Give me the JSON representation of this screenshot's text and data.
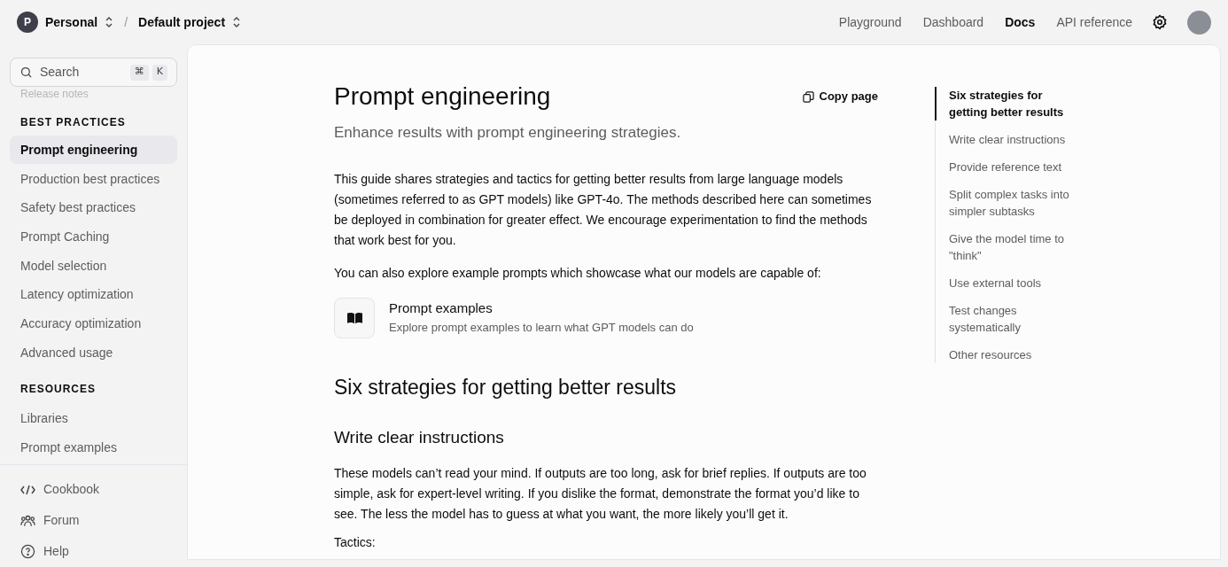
{
  "top_bar": {
    "org_initial": "P",
    "org": "Personal",
    "separator": "/",
    "project": "Default project",
    "nav": [
      {
        "label": "Playground",
        "selected": false
      },
      {
        "label": "Dashboard",
        "selected": false
      },
      {
        "label": "Docs",
        "selected": true
      },
      {
        "label": "API reference",
        "selected": false
      }
    ]
  },
  "sidebar": {
    "search": {
      "placeholder": "Search",
      "shortcut": [
        "⌘",
        "K"
      ]
    },
    "partial_item": "Release notes",
    "sections": [
      {
        "heading": "BEST PRACTICES",
        "items": [
          {
            "label": "Prompt engineering",
            "selected": true
          },
          {
            "label": "Production best practices",
            "selected": false
          },
          {
            "label": "Safety best practices",
            "selected": false
          },
          {
            "label": "Prompt Caching",
            "selected": false
          },
          {
            "label": "Model selection",
            "selected": false
          },
          {
            "label": "Latency optimization",
            "selected": false
          },
          {
            "label": "Accuracy optimization",
            "selected": false
          },
          {
            "label": "Advanced usage",
            "selected": false
          }
        ]
      },
      {
        "heading": "RESOURCES",
        "items": [
          {
            "label": "Libraries",
            "selected": false
          },
          {
            "label": "Prompt examples",
            "selected": false
          }
        ]
      }
    ],
    "footer_links": [
      {
        "kind": "code",
        "label": "Cookbook"
      },
      {
        "kind": "people",
        "label": "Forum"
      },
      {
        "kind": "help",
        "label": "Help"
      }
    ]
  },
  "article": {
    "title": "Prompt engineering",
    "copy_button": "Copy page",
    "subtitle": "Enhance results with prompt engineering strategies.",
    "intro": "This guide shares strategies and tactics for getting better results from large language models (sometimes referred to as GPT models) like GPT-4o. The methods described here can sometimes be deployed in combination for greater effect. We encourage experimentation to find the methods that work best for you.",
    "examples_intro": "You can also explore example prompts which showcase what our models are capable of:",
    "card": {
      "title": "Prompt examples",
      "description": "Explore prompt examples to learn what GPT models can do"
    },
    "h2": "Six strategies for getting better results",
    "h3": "Write clear instructions",
    "body": "These models can’t read your mind. If outputs are too long, ask for brief replies. If outputs are too simple, ask for expert-level writing. If you dislike the format, demonstrate the format you’d like to see. The less the model has to guess at what you want, the more likely you’ll get it.",
    "tactics": "Tactics:"
  },
  "toc": [
    {
      "label": "Six strategies for getting better results",
      "selected": true
    },
    {
      "label": "Write clear instructions",
      "selected": false
    },
    {
      "label": "Provide reference text",
      "selected": false
    },
    {
      "label": "Split complex tasks into simpler subtasks",
      "selected": false
    },
    {
      "label": "Give the model time to \"think\"",
      "selected": false
    },
    {
      "label": "Use external tools",
      "selected": false
    },
    {
      "label": "Test changes systematically",
      "selected": false
    },
    {
      "label": "Other resources",
      "selected": false
    }
  ]
}
